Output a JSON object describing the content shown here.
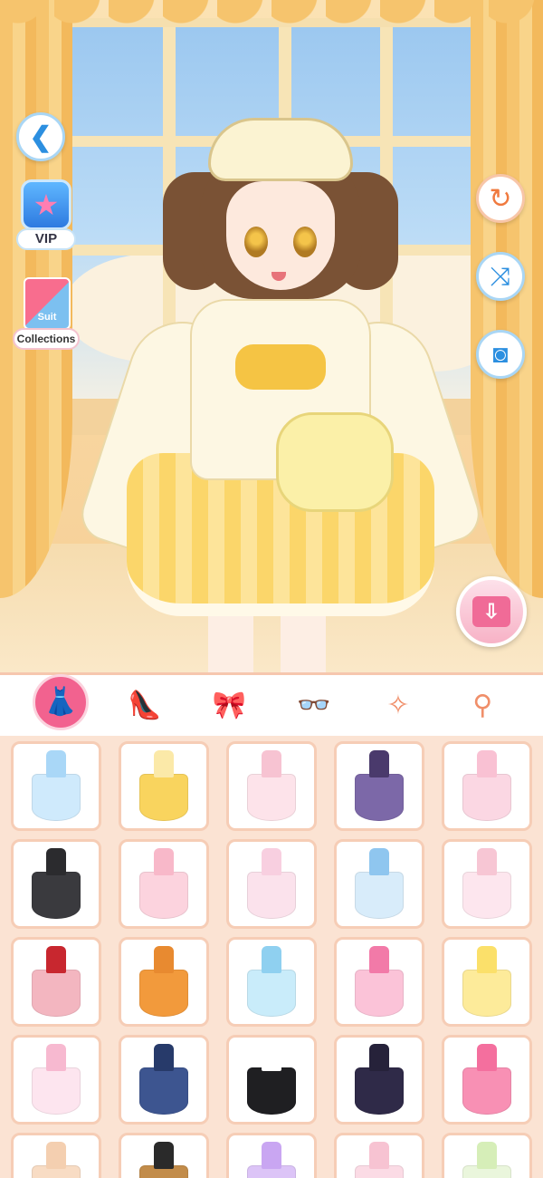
{
  "scene": {
    "alt": "room-with-window"
  },
  "left_buttons": {
    "back_icon": "back-arrow-icon",
    "vip_label": "VIP",
    "suit_label": "Suit",
    "collections_label": "Collections"
  },
  "right_buttons": {
    "reset_icon": "↻",
    "shuffle_icon": "⤨",
    "camera_icon": "◙",
    "save_icon": "⇩"
  },
  "back_glyph": "❮",
  "vip_star": "★",
  "tabs": [
    {
      "name": "dress",
      "glyph": "👗",
      "active": true
    },
    {
      "name": "shoes",
      "glyph": "👠",
      "active": false
    },
    {
      "name": "headband",
      "glyph": "🎀",
      "active": false
    },
    {
      "name": "glasses",
      "glyph": "👓",
      "active": false
    },
    {
      "name": "earrings",
      "glyph": "✧",
      "active": false
    },
    {
      "name": "necklace",
      "glyph": "⚲",
      "active": false
    }
  ],
  "outfits": [
    {
      "top": "#a9d7f7",
      "skirt": "#cfeafc"
    },
    {
      "top": "#fbe9a8",
      "skirt": "#f9d45e"
    },
    {
      "top": "#f7c3d2",
      "skirt": "#fde3ea"
    },
    {
      "top": "#4a3a6c",
      "skirt": "#7c68a8"
    },
    {
      "top": "#f9c1d3",
      "skirt": "#fbd7e3"
    },
    {
      "top": "#2b2b2e",
      "skirt": "#3a3a3e"
    },
    {
      "top": "#f8b8c9",
      "skirt": "#fcd3de"
    },
    {
      "top": "#f8cfe0",
      "skirt": "#fbe2ec"
    },
    {
      "top": "#8fc6ef",
      "skirt": "#d8ecfa"
    },
    {
      "top": "#f7c6d4",
      "skirt": "#fde6ee"
    },
    {
      "top": "#c8272f",
      "skirt": "#f3b6c0"
    },
    {
      "top": "#e88a30",
      "skirt": "#f29a3c"
    },
    {
      "top": "#8fd0f0",
      "skirt": "#c9ecfa"
    },
    {
      "top": "#f27aa8",
      "skirt": "#fbc3d8"
    },
    {
      "top": "#fbe06a",
      "skirt": "#fdeb9a"
    },
    {
      "top": "#f7b9d0",
      "skirt": "#fde5ef"
    },
    {
      "top": "#273a6a",
      "skirt": "#3d5590"
    },
    {
      "top": "#ffffff",
      "skirt": "#1f1f22"
    },
    {
      "top": "#26223a",
      "skirt": "#2f2a48"
    },
    {
      "top": "#f46f9e",
      "skirt": "#f890b4"
    },
    {
      "top": "#f4cfb0",
      "skirt": "#f8dcc4"
    },
    {
      "top": "#2a2a2a",
      "skirt": "#c28c4a"
    },
    {
      "top": "#c9a6f2",
      "skirt": "#dcc4f7"
    },
    {
      "top": "#f7c3d2",
      "skirt": "#fbdbe5"
    },
    {
      "top": "#d6eeb8",
      "skirt": "#eaf6dc"
    }
  ]
}
